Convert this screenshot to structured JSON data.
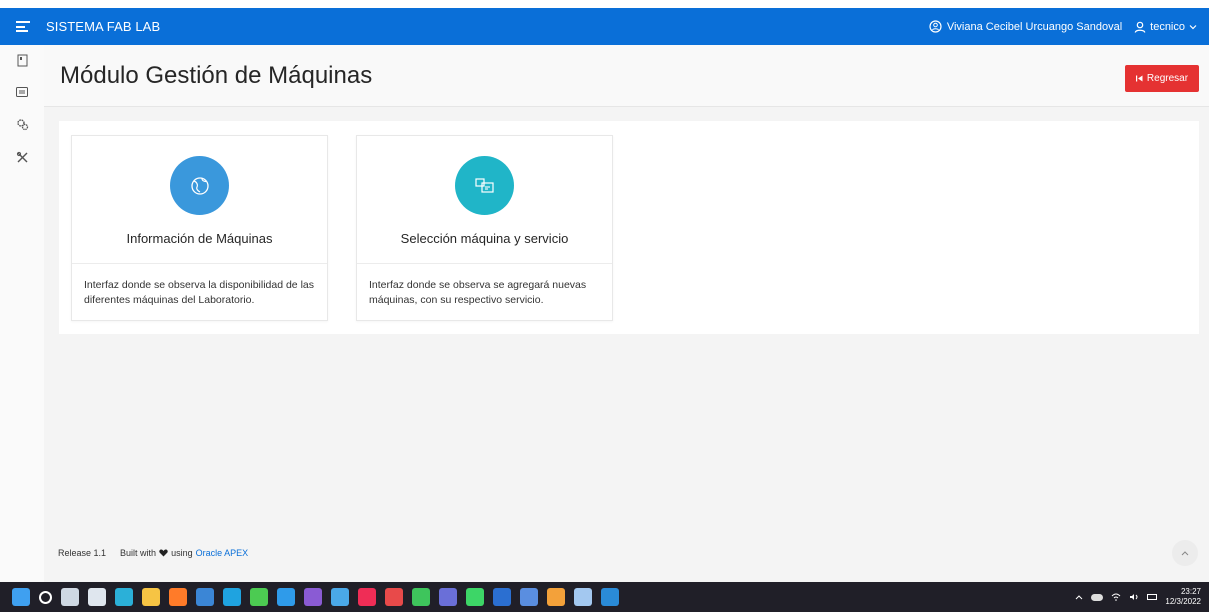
{
  "header": {
    "app_name": "SISTEMA FAB LAB",
    "user_fullname": "Viviana Cecibel Urcuango Sandoval",
    "username": "tecnico"
  },
  "sidenav": {
    "items": [
      {
        "icon": "page-icon"
      },
      {
        "icon": "list-icon"
      },
      {
        "icon": "gears-icon"
      },
      {
        "icon": "tools-icon"
      }
    ]
  },
  "page": {
    "title": "Módulo Gestión de Máquinas",
    "back_label": "Regresar"
  },
  "cards": [
    {
      "title": "Información de Máquinas",
      "description": "Interfaz donde se observa la disponibilidad de las diferentes máquinas del Laboratorio.",
      "icon": "globe-icon",
      "color": "#3a98dc"
    },
    {
      "title": "Selección máquina y servicio",
      "description": "Interfaz donde se observa se agregará nuevas máquinas, con su respectivo servicio.",
      "icon": "machine-service-icon",
      "color": "#20b5c8"
    }
  ],
  "footer": {
    "release": "Release 1.1",
    "built_with": "Built with",
    "using": "using",
    "apex_link": "Oracle APEX"
  },
  "taskbar": {
    "time": "23:27",
    "date": "12/3/2022",
    "apps": [
      {
        "name": "windows-start",
        "color": "#3fa0f0"
      },
      {
        "name": "search",
        "color": "#ffffff"
      },
      {
        "name": "task-view",
        "color": "#cfd8e3"
      },
      {
        "name": "onedrive",
        "color": "#dfe6ee"
      },
      {
        "name": "edge",
        "color": "#2bb0d8"
      },
      {
        "name": "file-explorer",
        "color": "#f6c444"
      },
      {
        "name": "firefox",
        "color": "#ff7b29"
      },
      {
        "name": "mail",
        "color": "#3b86d6"
      },
      {
        "name": "app-l",
        "color": "#1fa3e0"
      },
      {
        "name": "xbox",
        "color": "#4ccb52"
      },
      {
        "name": "vscode",
        "color": "#2f9bea"
      },
      {
        "name": "visual-studio",
        "color": "#8a5bd4"
      },
      {
        "name": "cube",
        "color": "#4aa8e8"
      },
      {
        "name": "illustrator",
        "color": "#ef2d56"
      },
      {
        "name": "mendeley",
        "color": "#e84a4a"
      },
      {
        "name": "whatsapp",
        "color": "#3ec55c"
      },
      {
        "name": "teams",
        "color": "#6a6fd8"
      },
      {
        "name": "spotify",
        "color": "#3dd667"
      },
      {
        "name": "word",
        "color": "#2b6fd1"
      },
      {
        "name": "dove",
        "color": "#5a8ee0"
      },
      {
        "name": "package",
        "color": "#f3a13a"
      },
      {
        "name": "notes",
        "color": "#a3c8f0"
      },
      {
        "name": "media",
        "color": "#2a8bd8"
      }
    ]
  }
}
